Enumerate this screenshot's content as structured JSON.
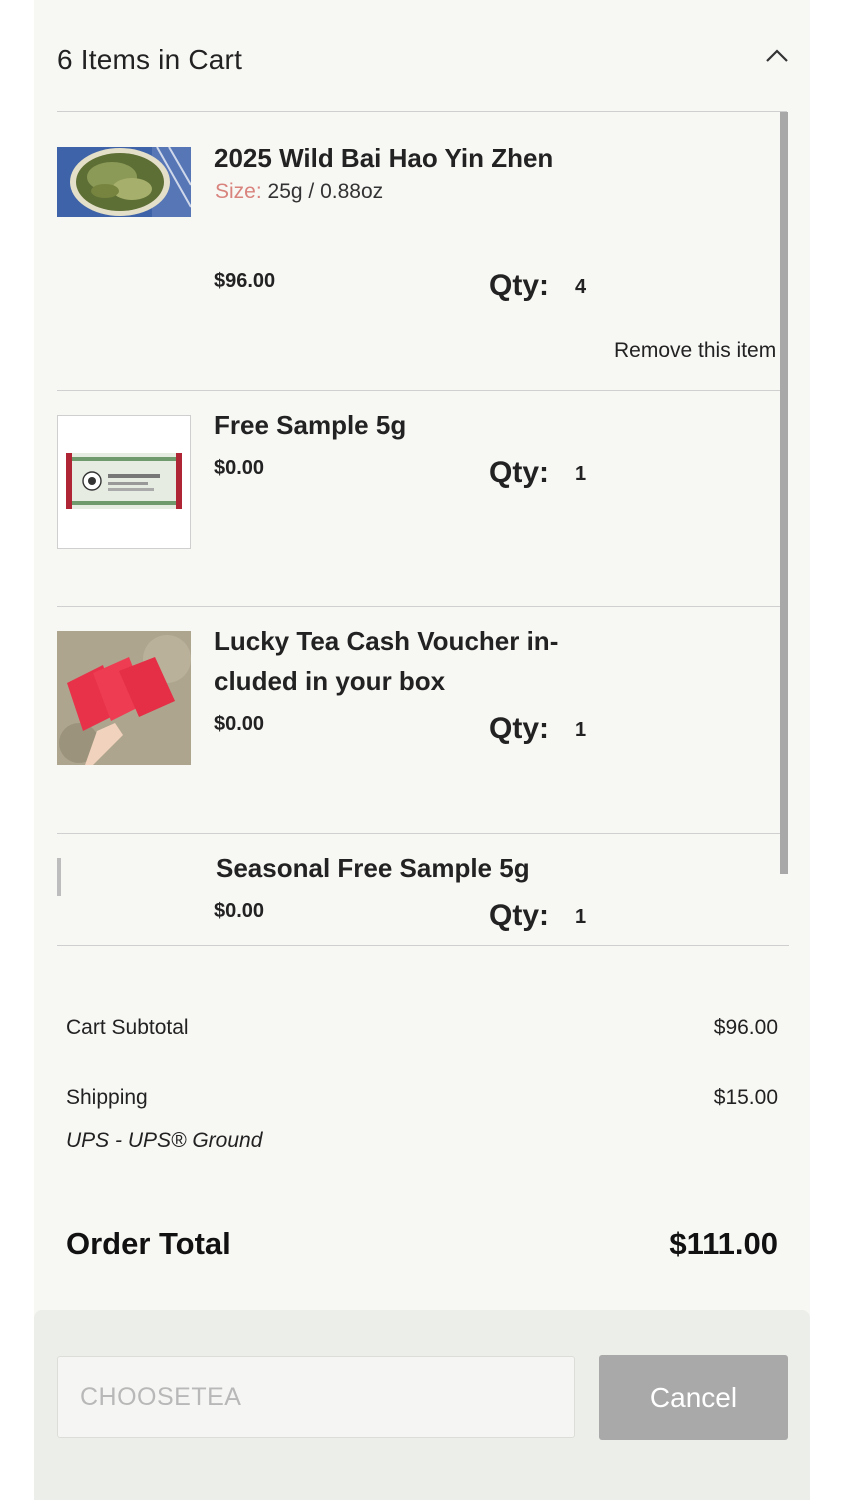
{
  "cart": {
    "title": "6 Items in Cart",
    "collapse_icon": "chevron-up-icon"
  },
  "items": [
    {
      "name": "2025 Wild Bai Hao Yin Zhen",
      "size_label": "Size:",
      "size_value": "25g / 0.88oz",
      "price": "$96.00",
      "qty_label": "Qty:",
      "qty": "4",
      "remove": "Remove this item"
    },
    {
      "name": "Free Sample 5g",
      "price": "$0.00",
      "qty_label": "Qty:",
      "qty": "1"
    },
    {
      "name_line1": "Lucky Tea Cash Voucher in-",
      "name_line2": "cluded in your box",
      "price": "$0.00",
      "qty_label": "Qty:",
      "qty": "1"
    },
    {
      "name": "Seasonal Free Sample 5g",
      "price": "$0.00",
      "qty_label": "Qty:",
      "qty": "1"
    }
  ],
  "summary": {
    "subtotal_label": "Cart Subtotal",
    "subtotal_value": "$96.00",
    "shipping_label": "Shipping",
    "shipping_value": "$15.00",
    "shipping_method": "UPS - UPS® Ground",
    "total_label": "Order Total",
    "total_value": "$111.00"
  },
  "promo": {
    "placeholder": "CHOOSETEA",
    "cancel_label": "Cancel"
  },
  "colors": {
    "panel_bg": "#f7f7f4",
    "size_label": "#d9837d",
    "button_bg": "#a9a9a9",
    "voucher_red": "#e8324a"
  }
}
